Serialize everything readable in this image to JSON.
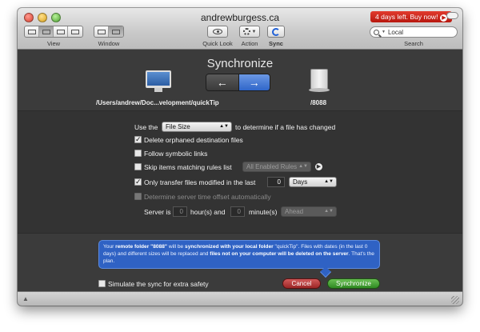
{
  "window": {
    "title": "andrewburgess.ca"
  },
  "toolbar": {
    "trial_badge": "4 days left. Buy now!",
    "view_label": "View",
    "window_label": "Window",
    "quicklook_label": "Quick Look",
    "action_label": "Action",
    "sync_label": "Sync",
    "search_value": "Local",
    "search_label": "Search"
  },
  "sync": {
    "title": "Synchronize",
    "local_path": "/Users/andrew/Doc...velopment/quickTip",
    "remote_path": "/8088",
    "direction": "local-to-remote"
  },
  "options": {
    "use_the": "Use the",
    "compare_select": "File Size",
    "compare_suffix": "to determine if a file has changed",
    "delete_orphaned": "Delete orphaned destination files",
    "delete_orphaned_checked": true,
    "follow_symlinks": "Follow symbolic links",
    "follow_symlinks_checked": false,
    "skip_rules": "Skip items matching rules list",
    "skip_rules_checked": false,
    "rules_select": "All Enabled Rules",
    "only_modified": "Only transfer files modified in the last",
    "only_modified_checked": true,
    "days_value": "0",
    "days_select": "Days",
    "server_offset": "Determine server time offset automatically",
    "server_is": "Server is",
    "hours_value": "0",
    "hours_label": "hour(s) and",
    "minutes_value": "0",
    "minutes_label": "minute(s)",
    "ahead_select": "Ahead"
  },
  "tooltip": {
    "part1": "Your ",
    "part2": "remote folder \"8088\"",
    "part3": " will be ",
    "part4": "synchronized with your local folder",
    "part5": " \"quickTip\". Files with dates (in the last 0 days) and different sizes will be replaced and ",
    "part6": "files not on your computer will be deleted on the server",
    "part7": ". That's the plan."
  },
  "footer": {
    "simulate": "Simulate the sync for extra safety",
    "simulate_checked": false,
    "cancel": "Cancel",
    "synchronize": "Synchronize"
  },
  "colors": {
    "accent": "#2f62c4",
    "cancel": "#9c2626",
    "synchronize": "#2f8a22",
    "badge": "#c21c12"
  }
}
